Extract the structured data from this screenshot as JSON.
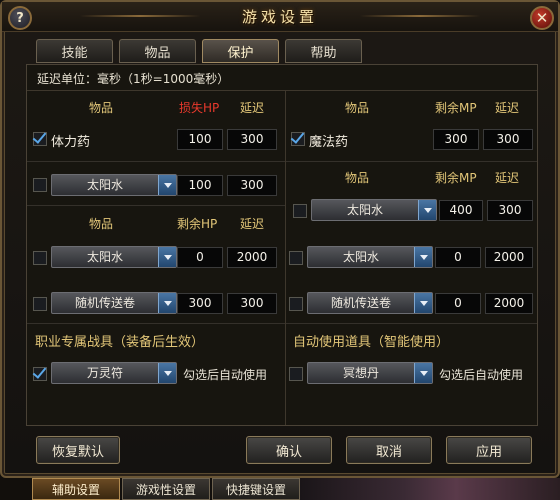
{
  "window": {
    "title": "游戏设置",
    "help_icon": "?",
    "close_icon": "✕"
  },
  "tabs": [
    {
      "label": "技能",
      "active": false
    },
    {
      "label": "物品",
      "active": false
    },
    {
      "label": "保护",
      "active": true
    },
    {
      "label": "帮助",
      "active": false
    }
  ],
  "note": "延迟单位：毫秒（1秒=1000毫秒）",
  "left": {
    "hp_header": {
      "item": "物品",
      "mid": "损失HP",
      "delay": "延迟"
    },
    "row1": {
      "checked": true,
      "label": "体力药",
      "value": "100",
      "delay": "300"
    },
    "row2": {
      "checked": false,
      "item": "太阳水",
      "value": "100",
      "delay": "300"
    },
    "hp_header2": {
      "item": "物品",
      "mid": "剩余HP",
      "delay": "延迟"
    },
    "row3": {
      "checked": false,
      "item": "太阳水",
      "value": "0",
      "delay": "2000"
    },
    "row4": {
      "checked": false,
      "item": "随机传送卷",
      "value": "300",
      "delay": "300"
    },
    "section_title": "职业专属战具（装备后生效）",
    "gear": {
      "checked": true,
      "item": "万灵符",
      "hint": "勾选后自动使用"
    }
  },
  "right": {
    "mp_header": {
      "item": "物品",
      "mid": "剩余MP",
      "delay": "延迟"
    },
    "row1": {
      "checked": true,
      "label": "魔法药",
      "value": "300",
      "delay": "300"
    },
    "mp_header2": {
      "item": "物品",
      "mid": "剩余MP",
      "delay": "延迟"
    },
    "row2": {
      "checked": false,
      "item": "太阳水",
      "value": "400",
      "delay": "300"
    },
    "row3": {
      "checked": false,
      "item": "太阳水",
      "value": "0",
      "delay": "2000"
    },
    "row4": {
      "checked": false,
      "item": "随机传送卷",
      "value": "0",
      "delay": "2000"
    },
    "section_title": "自动使用道具（智能使用）",
    "gear": {
      "checked": false,
      "item": "冥想丹",
      "hint": "勾选后自动使用"
    }
  },
  "buttons": {
    "reset": "恢复默认",
    "ok": "确认",
    "cancel": "取消",
    "apply": "应用"
  },
  "bottom_tabs": [
    {
      "label": "辅助设置",
      "active": true
    },
    {
      "label": "游戏性设置",
      "active": false
    },
    {
      "label": "快捷键设置",
      "active": false
    }
  ]
}
